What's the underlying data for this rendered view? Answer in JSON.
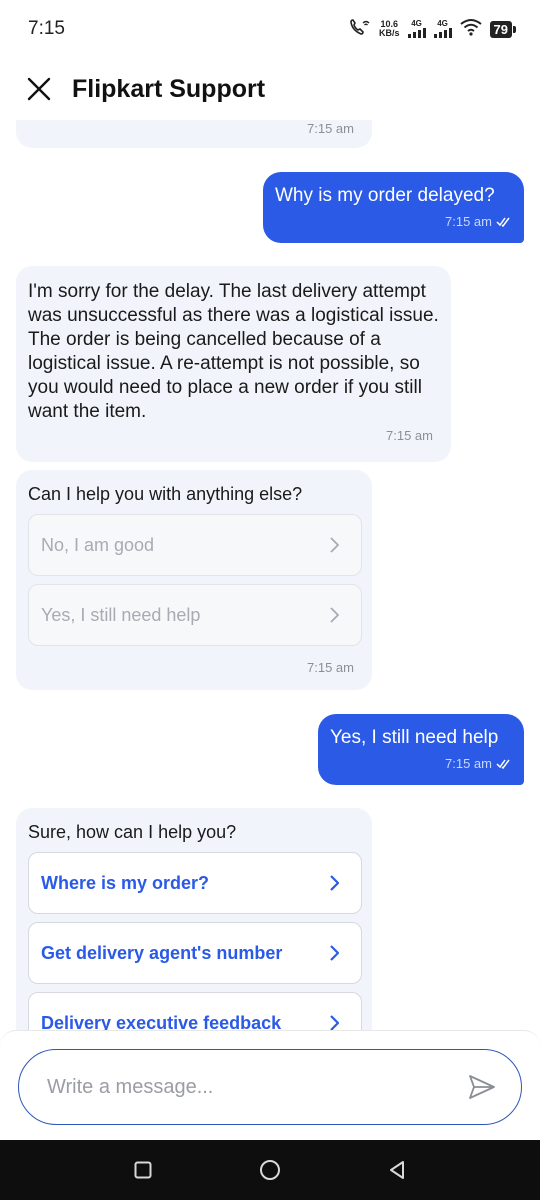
{
  "status_bar": {
    "time": "7:15",
    "speed_value": "10.6",
    "speed_unit": "KB/s",
    "net1": "4G",
    "net2": "4G",
    "battery": "79"
  },
  "header": {
    "title": "Flipkart Support"
  },
  "messages": {
    "top_bot_time": "7:15 am",
    "user1_text": "Why is my order delayed?",
    "user1_time": "7:15 am",
    "bot1_text": "I'm sorry for the delay. The last delivery attempt was unsuccessful as there was a logistical issue. The order is being cancelled because of a logistical issue. A re-attempt is not possible, so you would need to place a new order if you still want the item.",
    "bot1_time": "7:15 am",
    "bot2_prompt": "Can I help you with anything else?",
    "bot2_options": [
      "No, I am good",
      "Yes, I still need help"
    ],
    "bot2_time": "7:15 am",
    "user2_text": "Yes, I still need help",
    "user2_time": "7:15 am",
    "bot3_prompt": "Sure, how can I help you?",
    "bot3_options": [
      "Where is my order?",
      "Get delivery agent's number",
      "Delivery executive feedback"
    ]
  },
  "composer": {
    "placeholder": "Write a message..."
  },
  "colors": {
    "accent": "#2a5ae6",
    "bot_bubble": "#f1f5fb"
  }
}
